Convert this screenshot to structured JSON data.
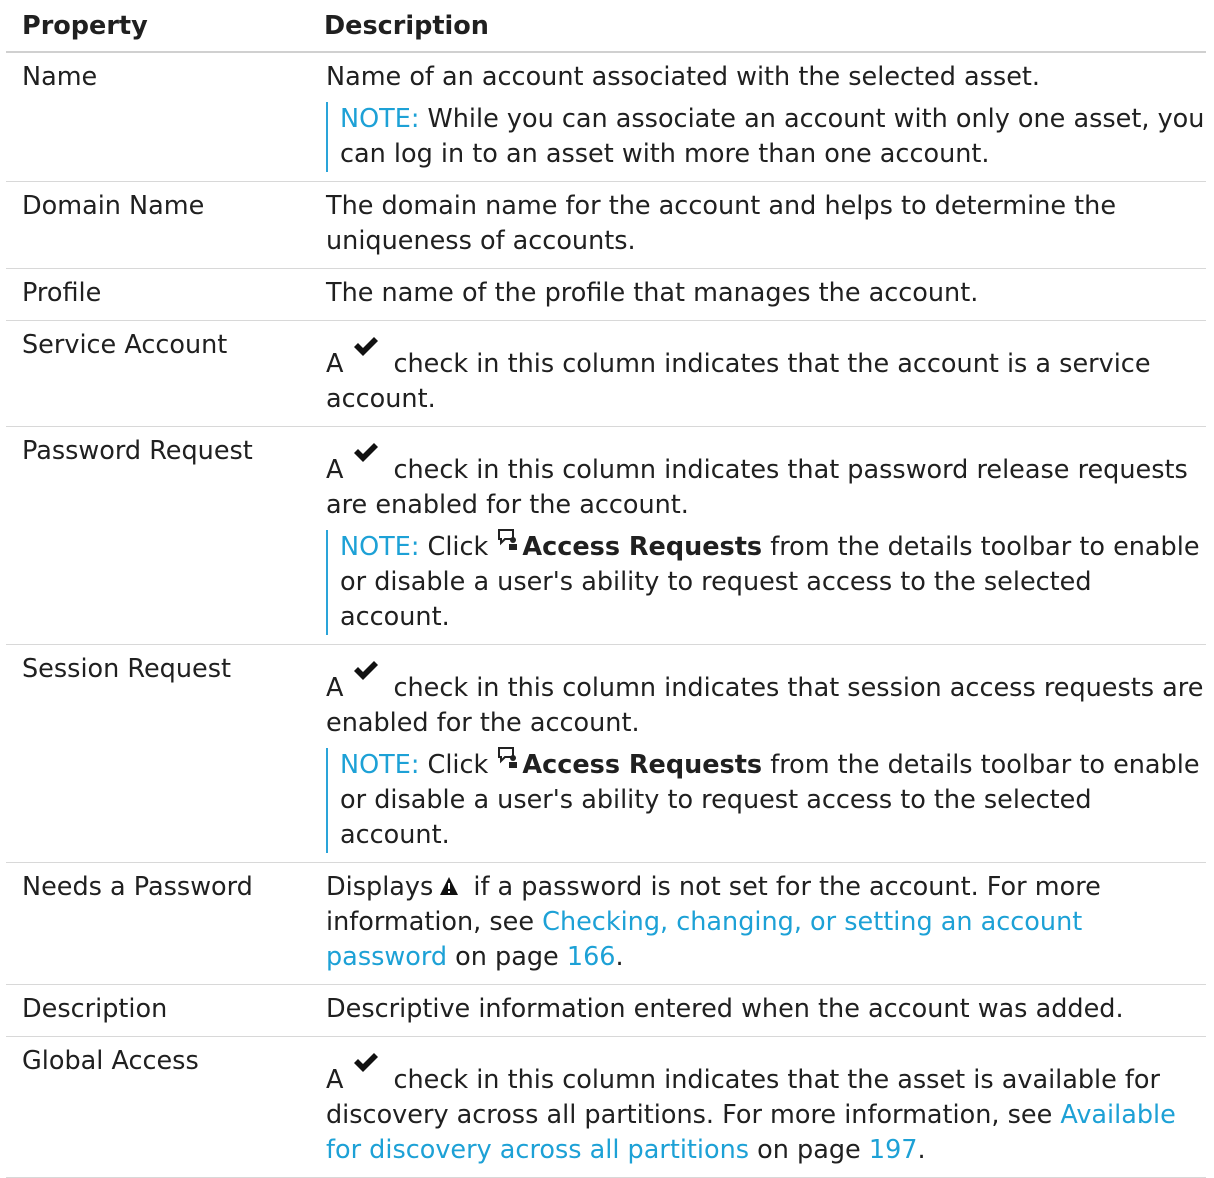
{
  "headers": {
    "property": "Property",
    "description": "Description"
  },
  "rows": {
    "name": {
      "prop": "Name",
      "text": "Name of an account associated with the selected asset.",
      "note_label": "NOTE:",
      "note_text": " While you can associate an account with only one asset, you can log in to an asset with more than one account."
    },
    "domain": {
      "prop": "Domain Name",
      "text": "The domain name for the account and helps to determine the uniqueness of accounts."
    },
    "profile": {
      "prop": "Profile",
      "text": "The name of the profile that manages the account."
    },
    "service": {
      "prop": "Service Account",
      "pre": "A",
      "text": "check in this column indicates that the account is a service account."
    },
    "password_request": {
      "prop": "Password Request",
      "pre": "A",
      "text": "check in this column indicates that password release requests are enabled for the account.",
      "note_label": "NOTE:",
      "note_pre": " Click ",
      "note_bold": "Access Requests",
      "note_post": " from the details toolbar to enable or disable a user's ability to request access to the selected account."
    },
    "session_request": {
      "prop": "Session Request",
      "pre": "A",
      "text": "check in this column indicates that session access requests are enabled for the account.",
      "note_label": "NOTE:",
      "note_pre": " Click ",
      "note_bold": "Access Requests",
      "note_post": " from the details toolbar to enable or disable a user's ability to request access to the selected account."
    },
    "needs_password": {
      "prop": "Needs a Password",
      "pre": "Displays",
      "text": " if a password is not set for the account. For more information, see ",
      "link": "Checking, changing, or setting an account password",
      "mid": " on page ",
      "page": "166",
      "end": "."
    },
    "description": {
      "prop": "Description",
      "text": "Descriptive information entered when the account was added."
    },
    "global_access": {
      "prop": "Global Access",
      "pre": "A",
      "text": "check in this column indicates that the asset is available for discovery across all partitions. For more information, see ",
      "link": "Available for discovery across all partitions",
      "mid": " on page ",
      "page": "197",
      "end": "."
    }
  },
  "icons": {
    "check": "checkmark-icon",
    "warning": "warning-triangle-icon",
    "access_requests": "access-requests-icon"
  },
  "colors": {
    "link": "#1da1d6",
    "note_bar": "#2aa4d9"
  }
}
